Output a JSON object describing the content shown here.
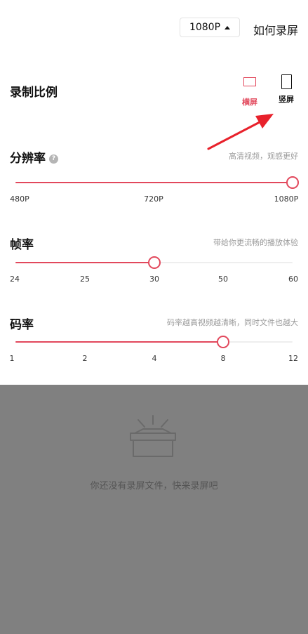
{
  "header": {
    "resolution_button": "1080P",
    "how_to_record": "如何录屏"
  },
  "ratio": {
    "title": "录制比例",
    "options": [
      {
        "label": "横屏",
        "selected": true
      },
      {
        "label": "竖屏",
        "selected": false
      }
    ]
  },
  "resolution": {
    "title": "分辨率",
    "help_icon": "?",
    "hint": "高清视频，观感更好",
    "ticks": [
      "480P",
      "720P",
      "1080P"
    ],
    "value_fraction": 1.0
  },
  "framerate": {
    "title": "帧率",
    "hint": "带给你更流畅的播放体验",
    "ticks": [
      "24",
      "25",
      "30",
      "50",
      "60"
    ],
    "value": "30",
    "value_fraction": 0.5
  },
  "bitrate": {
    "title": "码率",
    "hint": "码率越高视频越清晰，同时文件也越大",
    "ticks": [
      "1",
      "2",
      "4",
      "8",
      "12"
    ],
    "value": "8",
    "value_fraction": 0.75
  },
  "empty_state": {
    "text": "你还没有录屏文件，快来录屏吧"
  },
  "colors": {
    "accent": "#e2485c",
    "overlay": "#808080",
    "arrow": "#e8212b"
  }
}
